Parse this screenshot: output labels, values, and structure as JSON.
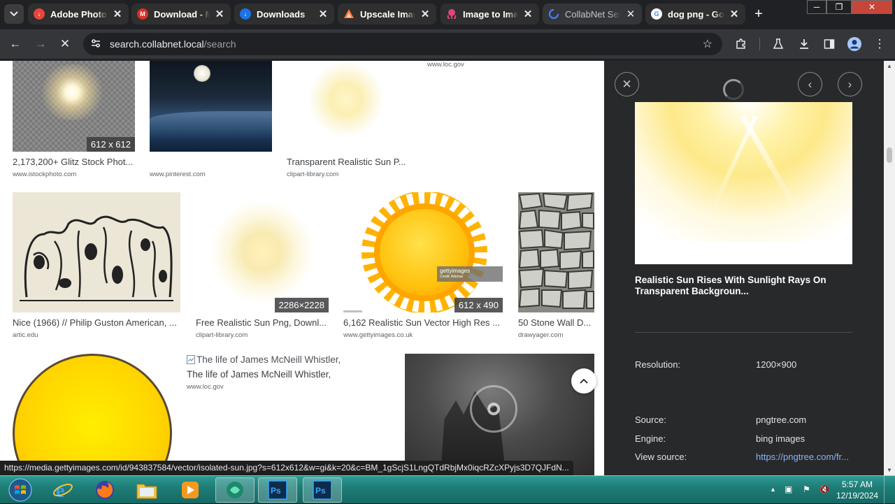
{
  "tabs": [
    {
      "label": "Adobe Photoshop",
      "favicon_color": "#e8453c",
      "favicon": "download-icon",
      "active": false
    },
    {
      "label": "Download - M",
      "favicon_color": "#d93025",
      "favicon": "M",
      "active": false
    },
    {
      "label": "Downloads",
      "favicon_color": "#1a73e8",
      "favicon": "download-icon",
      "active": false
    },
    {
      "label": "Upscale Image",
      "favicon_color": "#ff7a3d",
      "favicon": "upscale-icon",
      "active": false
    },
    {
      "label": "Image to Image",
      "favicon_color": "#e0457b",
      "favicon": "octopus-icon",
      "active": false
    },
    {
      "label": "CollabNet Search",
      "favicon_color": "#4285f4",
      "favicon": "loading-icon",
      "active": true
    },
    {
      "label": "dog png - Google",
      "favicon_color": "#ffffff",
      "favicon": "G",
      "active": false
    }
  ],
  "toolbar": {
    "url_host": "search.collabnet.local",
    "url_path": "/search"
  },
  "results": {
    "row0": [
      {
        "title": "2,173,200+ Glitz Stock Phot...",
        "source": "www.istockphoto.com",
        "size": "612 x 612"
      },
      {
        "title": "",
        "source": "www.pinterest.com",
        "size": ""
      },
      {
        "title": "Transparent Realistic Sun P...",
        "source": "clipart-library.com",
        "size": ""
      },
      {
        "title": "",
        "source": "www.loc.gov",
        "size": ""
      }
    ],
    "row1": [
      {
        "title": "Nice (1966) // Philip Guston American, ...",
        "source": "artic.edu",
        "size": ""
      },
      {
        "title": "Free Realistic Sun Png, Downl...",
        "source": "clipart-library.com",
        "size": "2286×2228"
      },
      {
        "title": "6,162 Realistic Sun Vector High Res ...",
        "source": "www.gettyimages.co.uk",
        "size": "612 x 490",
        "watermark": "gettyimages",
        "watermark_sub": "Credit: Ademar"
      },
      {
        "title": "50 Stone Wall D...",
        "source": "drawyager.com",
        "size": ""
      }
    ],
    "row2": [
      {
        "title": "",
        "source": "",
        "size": ""
      },
      {
        "title": "The life of James McNeill Whistler,",
        "source": "www.loc.gov",
        "size": "",
        "broken_alt": "The life of James McNeill Whistler,"
      },
      {
        "title": "",
        "source": "",
        "size": ""
      }
    ]
  },
  "preview": {
    "title": "Realistic Sun Rises With Sunlight Rays On Transparent Backgroun...",
    "details": [
      {
        "key": "Resolution:",
        "value": "1200×900"
      },
      {
        "key": "Source:",
        "value": "pngtree.com"
      },
      {
        "key": "Engine:",
        "value": "bing images"
      },
      {
        "key": "View source:",
        "value": "https://pngtree.com/fr..."
      }
    ]
  },
  "status_url": "https://media.gettyimages.com/id/943837584/vector/isolated-sun.jpg?s=612x612&w=gi&k=20&c=BM_1gScjS1LngQTdRbjMx0iqcRZcXPyjs3D7QJFdN...",
  "taskbar": {
    "time": "5:57 AM",
    "date": "12/19/2024",
    "apps": [
      "start-orb",
      "internet-explorer",
      "firefox",
      "file-explorer",
      "media-player",
      "app-green",
      "photoshop-alt",
      "photoshop"
    ]
  },
  "colors": {
    "accent_blue": "#8ab4f8",
    "taskbar": "#1f7d77",
    "sun_yellow": "#ffcc00"
  }
}
